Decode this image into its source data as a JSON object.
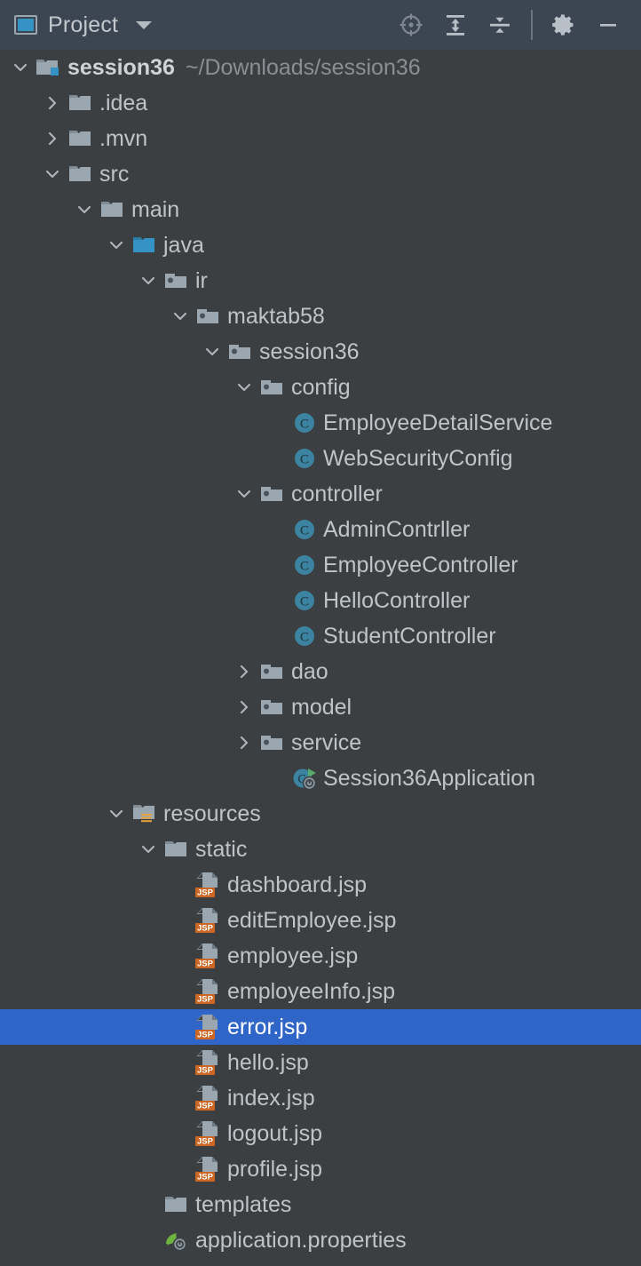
{
  "header": {
    "icon": "project-window-icon",
    "title": "Project",
    "dropdown_icon": "chevron-down-icon",
    "actions": [
      {
        "name": "locate-file-icon",
        "tooltip": "Select Opened File"
      },
      {
        "name": "expand-all-icon",
        "tooltip": "Expand All"
      },
      {
        "name": "collapse-all-icon",
        "tooltip": "Collapse All"
      },
      {
        "name": "settings-gear-icon",
        "tooltip": "Options"
      },
      {
        "name": "minimize-icon",
        "tooltip": "Hide"
      }
    ]
  },
  "colors": {
    "header_bg": "#3c4552",
    "tree_bg": "#3c3f41",
    "selection_bg": "#2f65c7",
    "text": "#bfc4c8",
    "text_dim": "#8a8f93",
    "text_selected": "#ffffff",
    "source_root_blue": "#3592c4",
    "class_icon_blue": "#3b83a0",
    "jsp_badge_orange": "#cc6622",
    "resources_badge_orange": "#e8a33d",
    "spring_green": "#6db33f"
  },
  "tree": {
    "rows": [
      {
        "depth": 0,
        "twisty": "expanded",
        "icon": "module-folder-icon",
        "label": "session36",
        "bold": true,
        "path": "~/Downloads/session36",
        "selected": false
      },
      {
        "depth": 1,
        "twisty": "collapsed",
        "icon": "folder-icon",
        "label": ".idea",
        "bold": false,
        "path": "",
        "selected": false
      },
      {
        "depth": 1,
        "twisty": "collapsed",
        "icon": "folder-icon",
        "label": ".mvn",
        "bold": false,
        "path": "",
        "selected": false
      },
      {
        "depth": 1,
        "twisty": "expanded",
        "icon": "folder-icon",
        "label": "src",
        "bold": false,
        "path": "",
        "selected": false
      },
      {
        "depth": 2,
        "twisty": "expanded",
        "icon": "folder-icon",
        "label": "main",
        "bold": false,
        "path": "",
        "selected": false
      },
      {
        "depth": 3,
        "twisty": "expanded",
        "icon": "source-root-folder-icon",
        "label": "java",
        "bold": false,
        "path": "",
        "selected": false
      },
      {
        "depth": 4,
        "twisty": "expanded",
        "icon": "package-icon",
        "label": "ir",
        "bold": false,
        "path": "",
        "selected": false
      },
      {
        "depth": 5,
        "twisty": "expanded",
        "icon": "package-icon",
        "label": "maktab58",
        "bold": false,
        "path": "",
        "selected": false
      },
      {
        "depth": 6,
        "twisty": "expanded",
        "icon": "package-icon",
        "label": "session36",
        "bold": false,
        "path": "",
        "selected": false
      },
      {
        "depth": 7,
        "twisty": "expanded",
        "icon": "package-icon",
        "label": "config",
        "bold": false,
        "path": "",
        "selected": false
      },
      {
        "depth": 8,
        "twisty": "none",
        "icon": "java-class-icon",
        "label": "EmployeeDetailService",
        "bold": false,
        "path": "",
        "selected": false
      },
      {
        "depth": 8,
        "twisty": "none",
        "icon": "java-class-icon",
        "label": "WebSecurityConfig",
        "bold": false,
        "path": "",
        "selected": false
      },
      {
        "depth": 7,
        "twisty": "expanded",
        "icon": "package-icon",
        "label": "controller",
        "bold": false,
        "path": "",
        "selected": false
      },
      {
        "depth": 8,
        "twisty": "none",
        "icon": "java-class-icon",
        "label": "AdminContrller",
        "bold": false,
        "path": "",
        "selected": false
      },
      {
        "depth": 8,
        "twisty": "none",
        "icon": "java-class-icon",
        "label": "EmployeeController",
        "bold": false,
        "path": "",
        "selected": false
      },
      {
        "depth": 8,
        "twisty": "none",
        "icon": "java-class-icon",
        "label": "HelloController",
        "bold": false,
        "path": "",
        "selected": false
      },
      {
        "depth": 8,
        "twisty": "none",
        "icon": "java-class-icon",
        "label": "StudentController",
        "bold": false,
        "path": "",
        "selected": false
      },
      {
        "depth": 7,
        "twisty": "collapsed",
        "icon": "package-icon",
        "label": "dao",
        "bold": false,
        "path": "",
        "selected": false
      },
      {
        "depth": 7,
        "twisty": "collapsed",
        "icon": "package-icon",
        "label": "model",
        "bold": false,
        "path": "",
        "selected": false
      },
      {
        "depth": 7,
        "twisty": "collapsed",
        "icon": "package-icon",
        "label": "service",
        "bold": false,
        "path": "",
        "selected": false
      },
      {
        "depth": 8,
        "twisty": "none",
        "icon": "spring-boot-application-icon",
        "label": "Session36Application",
        "bold": false,
        "path": "",
        "selected": false
      },
      {
        "depth": 3,
        "twisty": "expanded",
        "icon": "resources-root-folder-icon",
        "label": "resources",
        "bold": false,
        "path": "",
        "selected": false
      },
      {
        "depth": 4,
        "twisty": "expanded",
        "icon": "folder-icon",
        "label": "static",
        "bold": false,
        "path": "",
        "selected": false
      },
      {
        "depth": 5,
        "twisty": "none",
        "icon": "jsp-file-icon",
        "label": "dashboard.jsp",
        "bold": false,
        "path": "",
        "selected": false
      },
      {
        "depth": 5,
        "twisty": "none",
        "icon": "jsp-file-icon",
        "label": "editEmployee.jsp",
        "bold": false,
        "path": "",
        "selected": false
      },
      {
        "depth": 5,
        "twisty": "none",
        "icon": "jsp-file-icon",
        "label": "employee.jsp",
        "bold": false,
        "path": "",
        "selected": false
      },
      {
        "depth": 5,
        "twisty": "none",
        "icon": "jsp-file-icon",
        "label": "employeeInfo.jsp",
        "bold": false,
        "path": "",
        "selected": false
      },
      {
        "depth": 5,
        "twisty": "none",
        "icon": "jsp-file-icon",
        "label": "error.jsp",
        "bold": false,
        "path": "",
        "selected": true
      },
      {
        "depth": 5,
        "twisty": "none",
        "icon": "jsp-file-icon",
        "label": "hello.jsp",
        "bold": false,
        "path": "",
        "selected": false
      },
      {
        "depth": 5,
        "twisty": "none",
        "icon": "jsp-file-icon",
        "label": "index.jsp",
        "bold": false,
        "path": "",
        "selected": false
      },
      {
        "depth": 5,
        "twisty": "none",
        "icon": "jsp-file-icon",
        "label": "logout.jsp",
        "bold": false,
        "path": "",
        "selected": false
      },
      {
        "depth": 5,
        "twisty": "none",
        "icon": "jsp-file-icon",
        "label": "profile.jsp",
        "bold": false,
        "path": "",
        "selected": false
      },
      {
        "depth": 4,
        "twisty": "none",
        "icon": "folder-icon",
        "label": "templates",
        "bold": false,
        "path": "",
        "selected": false
      },
      {
        "depth": 4,
        "twisty": "none",
        "icon": "spring-properties-icon",
        "label": "application.properties",
        "bold": false,
        "path": "",
        "selected": false
      }
    ]
  }
}
